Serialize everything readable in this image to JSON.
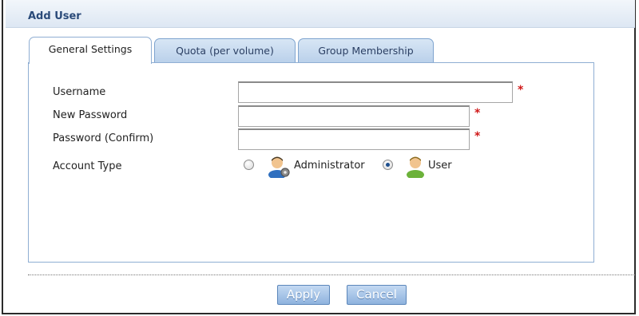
{
  "window": {
    "title": "Add User"
  },
  "tabs": [
    {
      "label": "General Settings",
      "active": true
    },
    {
      "label": "Quota (per volume)",
      "active": false
    },
    {
      "label": "Group Membership",
      "active": false
    }
  ],
  "form": {
    "username": {
      "label": "Username",
      "value": "",
      "required_mark": "*"
    },
    "new_password": {
      "label": "New Password",
      "value": "",
      "required_mark": "*"
    },
    "password_confirm": {
      "label": "Password (Confirm)",
      "value": "",
      "required_mark": "*"
    },
    "account_type": {
      "label": "Account Type",
      "options": [
        {
          "label": "Administrator",
          "icon": "admin-user-icon",
          "checked": false
        },
        {
          "label": "User",
          "icon": "user-icon",
          "checked": true
        }
      ]
    }
  },
  "buttons": {
    "apply": "Apply",
    "cancel": "Cancel"
  },
  "colors": {
    "title_text": "#2a4a79",
    "tab_border": "#7fa4cf",
    "panel_border": "#8faed3",
    "required": "#d01818",
    "button_bg": "#8fb3de"
  }
}
